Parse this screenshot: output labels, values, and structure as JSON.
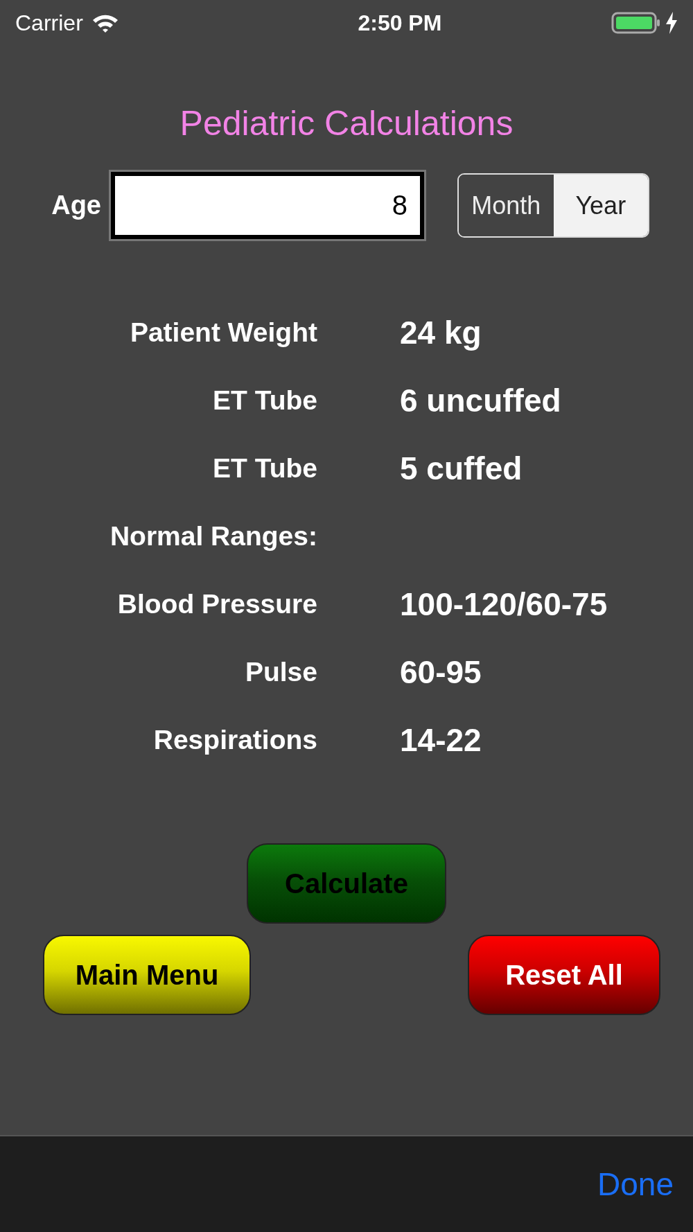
{
  "status_bar": {
    "carrier": "Carrier",
    "time": "2:50 PM",
    "charging": true
  },
  "title": "Pediatric Calculations",
  "age": {
    "label": "Age",
    "value": "8"
  },
  "unit_toggle": [
    {
      "label": "Month",
      "selected": false
    },
    {
      "label": "Year",
      "selected": true
    }
  ],
  "results": [
    {
      "label": "Patient Weight",
      "value": "24 kg"
    },
    {
      "label": "ET Tube",
      "value": "6 uncuffed"
    },
    {
      "label": "ET Tube",
      "value": "5 cuffed"
    },
    {
      "label": "Normal Ranges:"
    },
    {
      "label": "Blood Pressure",
      "value": "100-120/60-75"
    },
    {
      "label": "Pulse",
      "value": "60-95"
    },
    {
      "label": "Respirations",
      "value": "14-22"
    }
  ],
  "buttons": [
    {
      "label": "Calculate",
      "kind": "calculate"
    },
    {
      "label": "Main Menu",
      "kind": "menu"
    },
    {
      "label": "Reset All",
      "kind": "reset"
    }
  ],
  "toolbar": {
    "done": "Done"
  }
}
